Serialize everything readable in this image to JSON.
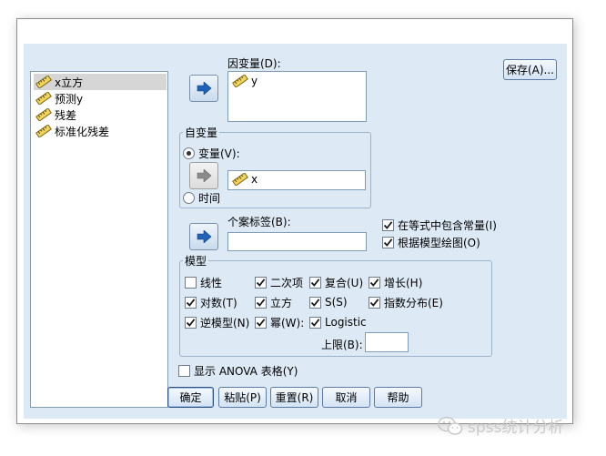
{
  "dialog": {
    "variables": [
      {
        "label": "x立方",
        "icon": "ruler-icon",
        "selected": true
      },
      {
        "label": "预测y",
        "icon": "ruler-icon",
        "selected": false
      },
      {
        "label": "残差",
        "icon": "ruler-icon",
        "selected": false
      },
      {
        "label": "标准化残差",
        "icon": "ruler-icon",
        "selected": false
      }
    ],
    "dependent": {
      "label": "因变量(D):",
      "value": "y"
    },
    "save_button": "保存(A)...",
    "independent": {
      "group_title": "自变量",
      "variable_option": "变量(V):",
      "time_option": "时间",
      "variable_value": "x",
      "selected": "variable"
    },
    "case_labels": {
      "label": "个案标签(B):",
      "value": ""
    },
    "include_constant": {
      "label": "在等式中包含常量(I)",
      "checked": true
    },
    "plot_models": {
      "label": "根据模型绘图(O)",
      "checked": true
    },
    "models": {
      "group_title": "模型",
      "items": [
        {
          "label": "线性",
          "checked": false
        },
        {
          "label": "二次项",
          "checked": true
        },
        {
          "label": "复合(U)",
          "checked": true
        },
        {
          "label": "增长(H)",
          "checked": true
        },
        {
          "label": "对数(T)",
          "checked": true
        },
        {
          "label": "立方",
          "checked": true
        },
        {
          "label": "S(S)",
          "checked": true
        },
        {
          "label": "指数分布(E)",
          "checked": true
        },
        {
          "label": "逆模型(N)",
          "checked": true
        },
        {
          "label": "幂(W):",
          "checked": true
        },
        {
          "label": "Logistic",
          "checked": true
        }
      ],
      "upper_bound_label": "上限(B):",
      "upper_bound_value": ""
    },
    "anova": {
      "label": "显示 ANOVA 表格(Y)",
      "checked": false
    },
    "buttons": {
      "ok": "确定",
      "paste": "粘贴(P)",
      "reset": "重置(R)",
      "cancel": "取消",
      "help": "帮助"
    }
  },
  "watermark": {
    "text": "spss统计分析",
    "icon": "wechat-icon"
  },
  "colors": {
    "client_bg": "#dde9f5",
    "arrow_blue": "#1f63b8",
    "list_border": "#7f9db9"
  }
}
